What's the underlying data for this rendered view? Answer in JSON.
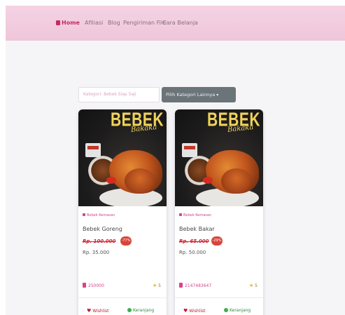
{
  "nav": {
    "items": [
      {
        "label": "Home",
        "active": true
      },
      {
        "label": "Afiliasi"
      },
      {
        "label": "Blog"
      },
      {
        "label": "Pengiriman File"
      },
      {
        "label": "Cara Belanja"
      }
    ]
  },
  "filter": {
    "category_placeholder": "Kategori: Bebek Siap Saji",
    "dropdown_label": "Pilih Kategori Lainnya"
  },
  "products": [
    {
      "image_title": "BEBEK",
      "image_subtitle": "Bakaka",
      "category": "Bebek Kemasan",
      "name": "Bebek Goreng",
      "old_price": "Rp. 100.000",
      "discount": "-77%",
      "price": "Rp. 35.000",
      "phone": "250000",
      "rating": "5",
      "wishlist_label": "Wishlist",
      "cart_label": "Keranjang"
    },
    {
      "image_title": "BEBEK",
      "image_subtitle": "Bakaka",
      "category": "Bebek Kemasan",
      "name": "Bebek Bakar",
      "old_price": "Rp. 65.000",
      "discount": "-29%",
      "price": "Rp. 50.000",
      "phone": "2147483647",
      "rating": "5",
      "wishlist_label": "Wishlist",
      "cart_label": "Keranjang"
    }
  ],
  "colors": {
    "navbar": "#efc6da",
    "brand": "#c42b6b",
    "accent_pink": "#d6448a",
    "price_red": "#d01e2e",
    "dropdown_bg": "#6b7478"
  }
}
